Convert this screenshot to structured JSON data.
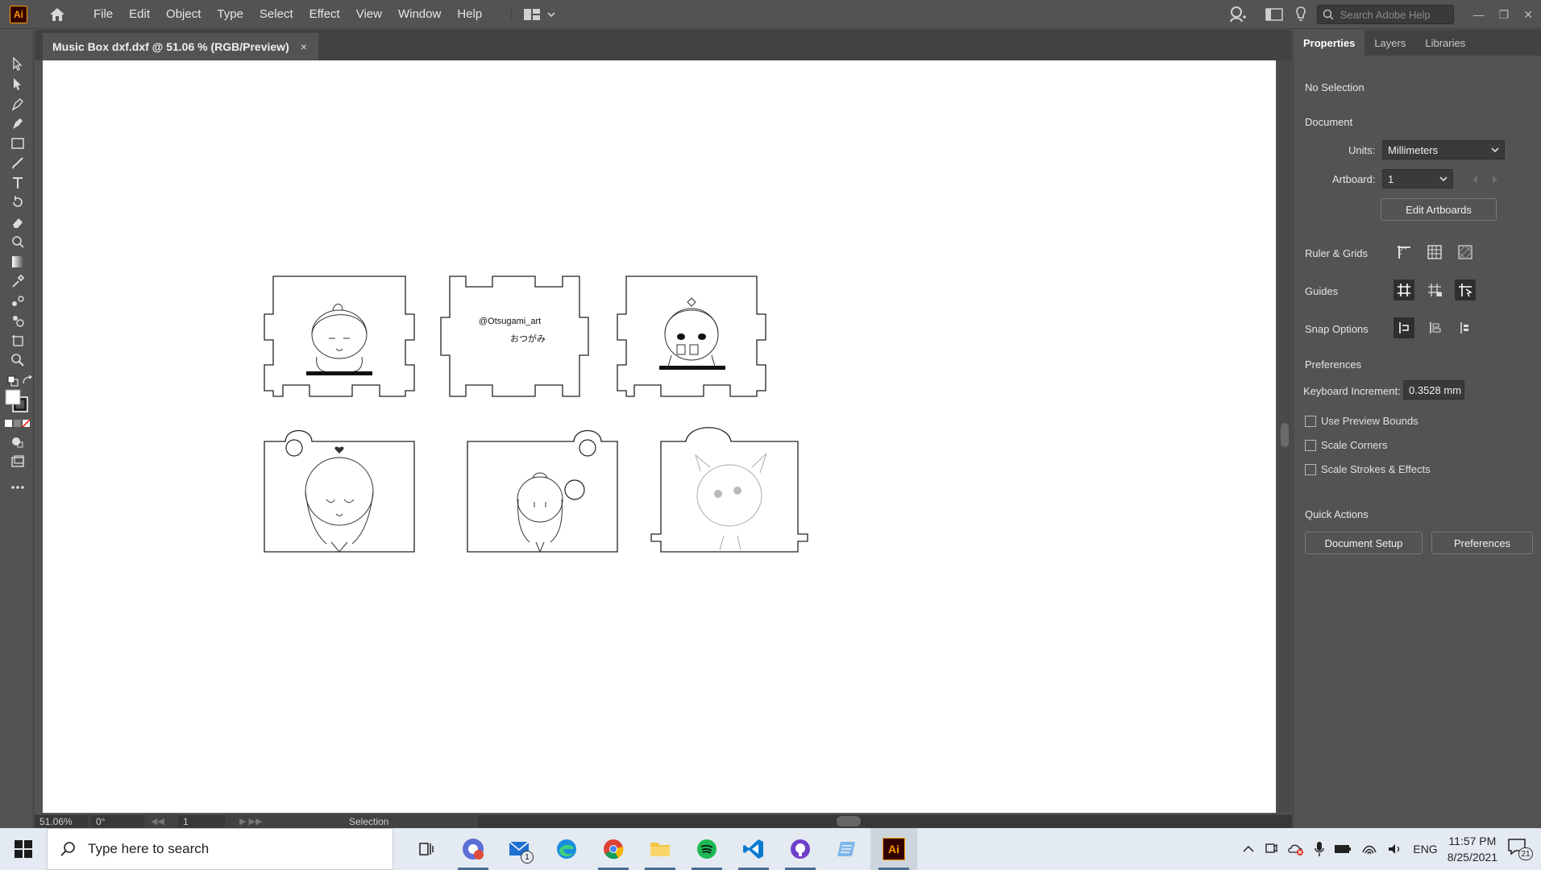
{
  "app": {
    "logo": "Ai"
  },
  "menu": [
    "File",
    "Edit",
    "Object",
    "Type",
    "Select",
    "Effect",
    "View",
    "Window",
    "Help"
  ],
  "search": {
    "placeholder": "Search Adobe Help"
  },
  "document": {
    "tab_title": "Music Box dxf.dxf @ 51.06 % (RGB/Preview)",
    "close": "×"
  },
  "artwork": {
    "handle_text": "@Otsugami_art",
    "jp_text": "おつがみ"
  },
  "status": {
    "zoom": "51.06%",
    "rotation": "0°",
    "artboard": "1",
    "tool": "Selection"
  },
  "panel": {
    "tabs": [
      "Properties",
      "Layers",
      "Libraries"
    ],
    "no_selection": "No Selection",
    "document_heading": "Document",
    "units_label": "Units:",
    "units_value": "Millimeters",
    "artboard_label": "Artboard:",
    "artboard_value": "1",
    "edit_artboards": "Edit Artboards",
    "ruler_grids": "Ruler & Grids",
    "guides": "Guides",
    "snap_options": "Snap Options",
    "preferences_heading": "Preferences",
    "keyboard_increment_label": "Keyboard Increment:",
    "keyboard_increment_value": "0.3528 mm",
    "checkboxes": [
      "Use Preview Bounds",
      "Scale Corners",
      "Scale Strokes & Effects"
    ],
    "quick_actions": "Quick Actions",
    "document_setup": "Document Setup",
    "preferences_button": "Preferences"
  },
  "taskbar": {
    "search_placeholder": "Type here to search",
    "mail_badge": "1",
    "lang": "ENG",
    "time": "11:57 PM",
    "date": "8/25/2021",
    "notifications": "21"
  }
}
